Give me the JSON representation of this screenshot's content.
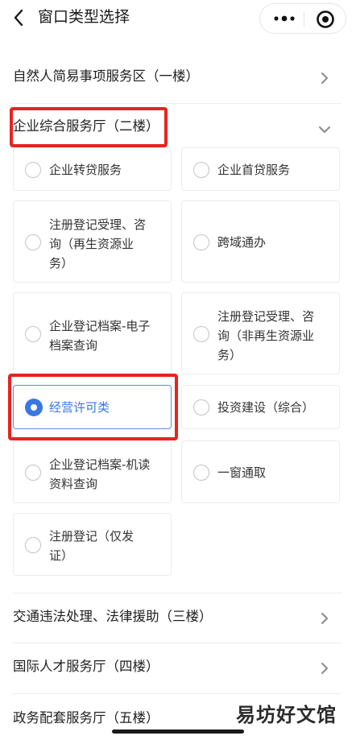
{
  "nav": {
    "title": "窗口类型选择"
  },
  "sections": [
    {
      "label": "自然人简易事项服务区（一楼）"
    },
    {
      "label": "企业综合服务厅（二楼）"
    },
    {
      "label": "交通违法处理、法律援助（三楼）"
    },
    {
      "label": "国际人才服务厅（四楼）"
    },
    {
      "label": "政务配套服务厅（五楼）"
    }
  ],
  "options": [
    {
      "lines": [
        "企业转贷服务"
      ],
      "selected": false
    },
    {
      "lines": [
        "企业首贷服务"
      ],
      "selected": false
    },
    {
      "lines": [
        "注册登记受理、咨",
        "询（再生资源业",
        "务）"
      ],
      "selected": false
    },
    {
      "lines": [
        "跨域通办"
      ],
      "selected": false
    },
    {
      "lines": [
        "企业登记档案-电子",
        "档案查询"
      ],
      "selected": false
    },
    {
      "lines": [
        "注册登记受理、咨",
        "询（非再生资源业",
        "务）"
      ],
      "selected": false
    },
    {
      "lines": [
        "经营许可类"
      ],
      "selected": true
    },
    {
      "lines": [
        "投资建设（综合）"
      ],
      "selected": false
    },
    {
      "lines": [
        "企业登记档案-机读",
        "资料查询"
      ],
      "selected": false
    },
    {
      "lines": [
        "一窗通取"
      ],
      "selected": false
    },
    {
      "lines": [
        "注册登记（仅发",
        "证）"
      ],
      "selected": false
    }
  ],
  "watermark": "易坊好文馆",
  "colors": {
    "accent": "#3a77e0",
    "highlight_border": "#e8231f"
  }
}
